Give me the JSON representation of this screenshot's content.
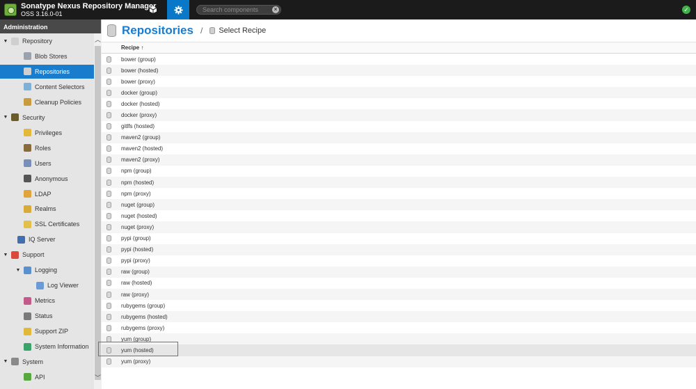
{
  "app": {
    "title": "Sonatype Nexus Repository Manager",
    "version": "OSS 3.16.0-01"
  },
  "topbar": {
    "browse_icon": "cube-icon",
    "admin_icon": "gear-icon",
    "search_placeholder": "Search components",
    "status_icon": "check-circle-icon",
    "accent": "#0a78c8"
  },
  "sidebar": {
    "header": "Administration",
    "items": [
      {
        "label": "Repository",
        "icon": "database-icon",
        "expander": "▼",
        "indent": 0,
        "color": "#cfcfcf"
      },
      {
        "label": "Blob Stores",
        "icon": "blobstore-icon",
        "expander": "",
        "indent": 1,
        "color": "#9aa3ad"
      },
      {
        "label": "Repositories",
        "icon": "database-icon",
        "expander": "",
        "indent": 1,
        "color": "#cfcfcf",
        "selected": true
      },
      {
        "label": "Content Selectors",
        "icon": "selector-icon",
        "expander": "",
        "indent": 1,
        "color": "#7fb0d8"
      },
      {
        "label": "Cleanup Policies",
        "icon": "broom-icon",
        "expander": "",
        "indent": 1,
        "color": "#c89b3c"
      },
      {
        "label": "Security",
        "icon": "security-eye-icon",
        "expander": "▼",
        "indent": 0,
        "color": "#6b5d2a"
      },
      {
        "label": "Privileges",
        "icon": "medal-icon",
        "expander": "",
        "indent": 1,
        "color": "#e2b93b"
      },
      {
        "label": "Roles",
        "icon": "roles-icon",
        "expander": "",
        "indent": 1,
        "color": "#8a6a3a"
      },
      {
        "label": "Users",
        "icon": "users-icon",
        "expander": "",
        "indent": 1,
        "color": "#7a8fb8"
      },
      {
        "label": "Anonymous",
        "icon": "anonymous-icon",
        "expander": "",
        "indent": 1,
        "color": "#555555"
      },
      {
        "label": "LDAP",
        "icon": "ldap-icon",
        "expander": "",
        "indent": 1,
        "color": "#e0a43a"
      },
      {
        "label": "Realms",
        "icon": "realms-icon",
        "expander": "",
        "indent": 1,
        "color": "#d9a93a"
      },
      {
        "label": "SSL Certificates",
        "icon": "certificate-icon",
        "expander": "",
        "indent": 1,
        "color": "#e2c04a"
      },
      {
        "label": "IQ Server",
        "icon": "iq-server-icon",
        "expander": "",
        "indent": 0.5,
        "color": "#3f6fb0"
      },
      {
        "label": "Support",
        "icon": "lifebuoy-icon",
        "expander": "▼",
        "indent": 0,
        "color": "#d9473d"
      },
      {
        "label": "Logging",
        "icon": "logging-icon",
        "expander": "▼",
        "indent": 1,
        "color": "#5a8fd0"
      },
      {
        "label": "Log Viewer",
        "icon": "log-viewer-icon",
        "expander": "",
        "indent": 2,
        "color": "#6a9bd8"
      },
      {
        "label": "Metrics",
        "icon": "metrics-icon",
        "expander": "",
        "indent": 1,
        "color": "#c45a8a"
      },
      {
        "label": "Status",
        "icon": "status-icon",
        "expander": "",
        "indent": 1,
        "color": "#7a7a7a"
      },
      {
        "label": "Support ZIP",
        "icon": "zip-icon",
        "expander": "",
        "indent": 1,
        "color": "#e0b93a"
      },
      {
        "label": "System Information",
        "icon": "globe-icon",
        "expander": "",
        "indent": 1,
        "color": "#3aa36a"
      },
      {
        "label": "System",
        "icon": "system-gear-icon",
        "expander": "▼",
        "indent": 0,
        "color": "#8a8a8a"
      },
      {
        "label": "API",
        "icon": "api-icon",
        "expander": "",
        "indent": 1,
        "color": "#58a840"
      }
    ]
  },
  "main": {
    "title": "Repositories",
    "breadcrumb_sep": "/",
    "breadcrumb": "Select Recipe",
    "column_header": "Recipe ↑",
    "recipes": [
      "bower (group)",
      "bower (hosted)",
      "bower (proxy)",
      "docker (group)",
      "docker (hosted)",
      "docker (proxy)",
      "gitlfs (hosted)",
      "maven2 (group)",
      "maven2 (hosted)",
      "maven2 (proxy)",
      "npm (group)",
      "npm (hosted)",
      "npm (proxy)",
      "nuget (group)",
      "nuget (hosted)",
      "nuget (proxy)",
      "pypi (group)",
      "pypi (hosted)",
      "pypi (proxy)",
      "raw (group)",
      "raw (hosted)",
      "raw (proxy)",
      "rubygems (group)",
      "rubygems (hosted)",
      "rubygems (proxy)",
      "yum (group)",
      "yum (hosted)",
      "yum (proxy)"
    ],
    "highlighted_recipe": "yum (hosted)",
    "highlight_color": "#e8403a"
  }
}
